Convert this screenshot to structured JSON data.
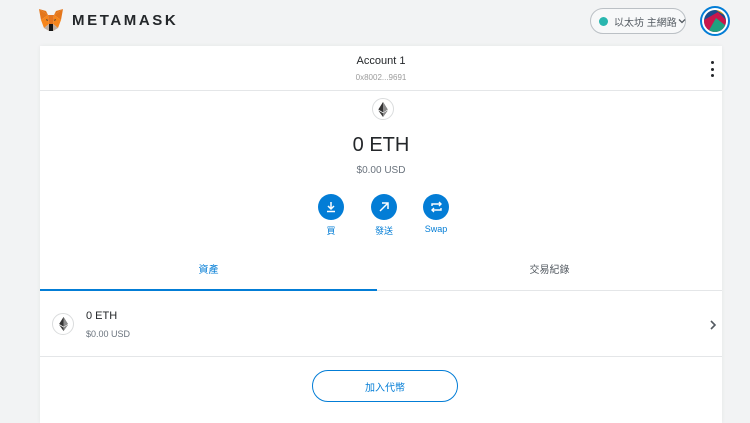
{
  "brand": {
    "wordmark": "METAMASK",
    "logo_icon": "metamask-fox-icon"
  },
  "network": {
    "label": "以太坊 主網路",
    "status_color": "#29b6af"
  },
  "account": {
    "name": "Account 1",
    "address": "0x8002...9691",
    "menu_icon": "kebab-menu-icon"
  },
  "balance": {
    "amount": "0 ETH",
    "fiat": "$0.00 USD",
    "icon": "ethereum-icon"
  },
  "actions": [
    {
      "label": "買",
      "icon": "download-icon"
    },
    {
      "label": "發送",
      "icon": "arrow-up-right-icon"
    },
    {
      "label": "Swap",
      "icon": "swap-icon"
    }
  ],
  "tabs": {
    "assets": "資產",
    "activity": "交易紀錄",
    "active": "assets"
  },
  "assets": [
    {
      "amount": "0 ETH",
      "fiat": "$0.00 USD",
      "icon": "ethereum-icon"
    }
  ],
  "add_token_label": "加入代幣",
  "colors": {
    "accent": "#037dd6",
    "background": "#f2f3f4",
    "text": "#24272a"
  }
}
